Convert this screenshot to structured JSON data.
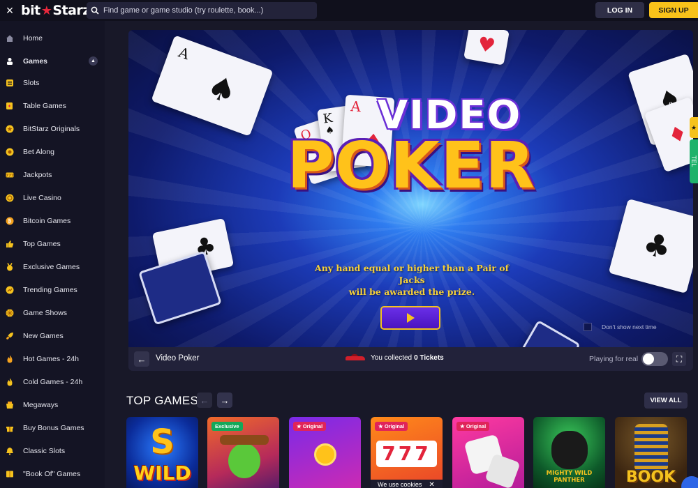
{
  "header": {
    "close_icon": "×",
    "logo_left": "bit",
    "logo_star": "★",
    "logo_right": "Starz",
    "search_placeholder": "Find game or game studio (try roulette, book...)",
    "login_label": "LOG IN",
    "signup_label": "SIGN UP",
    "accent_color": "#f9c21a"
  },
  "sidebar": {
    "items": [
      {
        "label": "Home",
        "icon": "home-icon"
      },
      {
        "label": "Games",
        "icon": "games-icon"
      },
      {
        "label": "Slots",
        "icon": "slots-icon"
      },
      {
        "label": "Table Games",
        "icon": "table-games-icon"
      },
      {
        "label": "BitStarz Originals",
        "icon": "originals-icon"
      },
      {
        "label": "Bet Along",
        "icon": "bet-along-icon"
      },
      {
        "label": "Jackpots",
        "icon": "jackpots-icon"
      },
      {
        "label": "Live Casino",
        "icon": "live-casino-icon"
      },
      {
        "label": "Bitcoin Games",
        "icon": "bitcoin-icon"
      },
      {
        "label": "Top Games",
        "icon": "thumbs-up-icon"
      },
      {
        "label": "Exclusive Games",
        "icon": "medal-icon"
      },
      {
        "label": "Trending Games",
        "icon": "trending-icon"
      },
      {
        "label": "Game Shows",
        "icon": "game-shows-icon"
      },
      {
        "label": "New Games",
        "icon": "rocket-icon"
      },
      {
        "label": "Hot Games - 24h",
        "icon": "flame-icon"
      },
      {
        "label": "Cold Games - 24h",
        "icon": "cold-flame-icon"
      },
      {
        "label": "Megaways",
        "icon": "megaways-icon"
      },
      {
        "label": "Buy Bonus Games",
        "icon": "gift-icon"
      },
      {
        "label": "Classic Slots",
        "icon": "bell-icon"
      },
      {
        "label": "\"Book Of\" Games",
        "icon": "book-icon"
      }
    ]
  },
  "banner": {
    "title_top": "VIDEO",
    "title_main": "POKER",
    "description_line1": "Any hand equal or higher than a Pair of Jacks",
    "description_line2": "will be awarded the prize.",
    "dont_show_label": "Don't show next time",
    "cards": [
      {
        "rank": "A",
        "suit": "♠"
      },
      {
        "rank": "Q",
        "suit": "♥"
      },
      {
        "rank": "K",
        "suit": "♠"
      },
      {
        "rank": "A",
        "suit": "♦"
      },
      {
        "rank": "",
        "suit": "♥"
      },
      {
        "rank": "",
        "suit": "♣"
      },
      {
        "rank": "",
        "suit": "♠"
      },
      {
        "rank": "",
        "suit": "♦"
      },
      {
        "rank": "",
        "suit": "♣"
      }
    ]
  },
  "game_bar": {
    "back_arrow": "←",
    "game_name": "Video Poker",
    "collected_prefix": "You collected",
    "tickets_value": "0 Tickets",
    "playing_for_real_label": "Playing for real",
    "playing_for_real_on": false,
    "fullscreen_icon": "⛶"
  },
  "side_tabs": {
    "green_label": "TEL"
  },
  "top_games": {
    "title": "TOP GAMES",
    "prev_arrow": "←",
    "next_arrow": "→",
    "view_all_label": "VIEW ALL",
    "tiles": [
      {
        "badge": "",
        "art_text": "WILD",
        "top_letter": "S"
      },
      {
        "badge": "Exclusive",
        "art_text": "",
        "top_letter": ""
      },
      {
        "badge": "Original",
        "art_text": "",
        "top_letter": ""
      },
      {
        "badge": "Original",
        "art_text": "777",
        "top_letter": ""
      },
      {
        "badge": "Original",
        "art_text": "",
        "top_letter": ""
      },
      {
        "badge": "",
        "art_text": "MIGHTY WILD PANTHER",
        "top_letter": ""
      },
      {
        "badge": "",
        "art_text": "BOOK",
        "top_letter": ""
      }
    ]
  },
  "cookie_notice": {
    "text": "We use cookies",
    "close": "✕"
  }
}
